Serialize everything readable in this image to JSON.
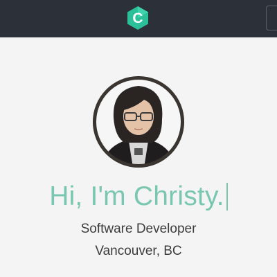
{
  "navbar": {
    "logo_icon": "c-hexagon-logo-icon",
    "logo_color": "#2bbf9a",
    "background": "#2c3038"
  },
  "profile": {
    "avatar_alt": "profile photo",
    "greeting": "Hi, I'm Christy.",
    "title": "Software Developer",
    "location": "Vancouver, BC",
    "accent_color": "#79c7b0"
  }
}
